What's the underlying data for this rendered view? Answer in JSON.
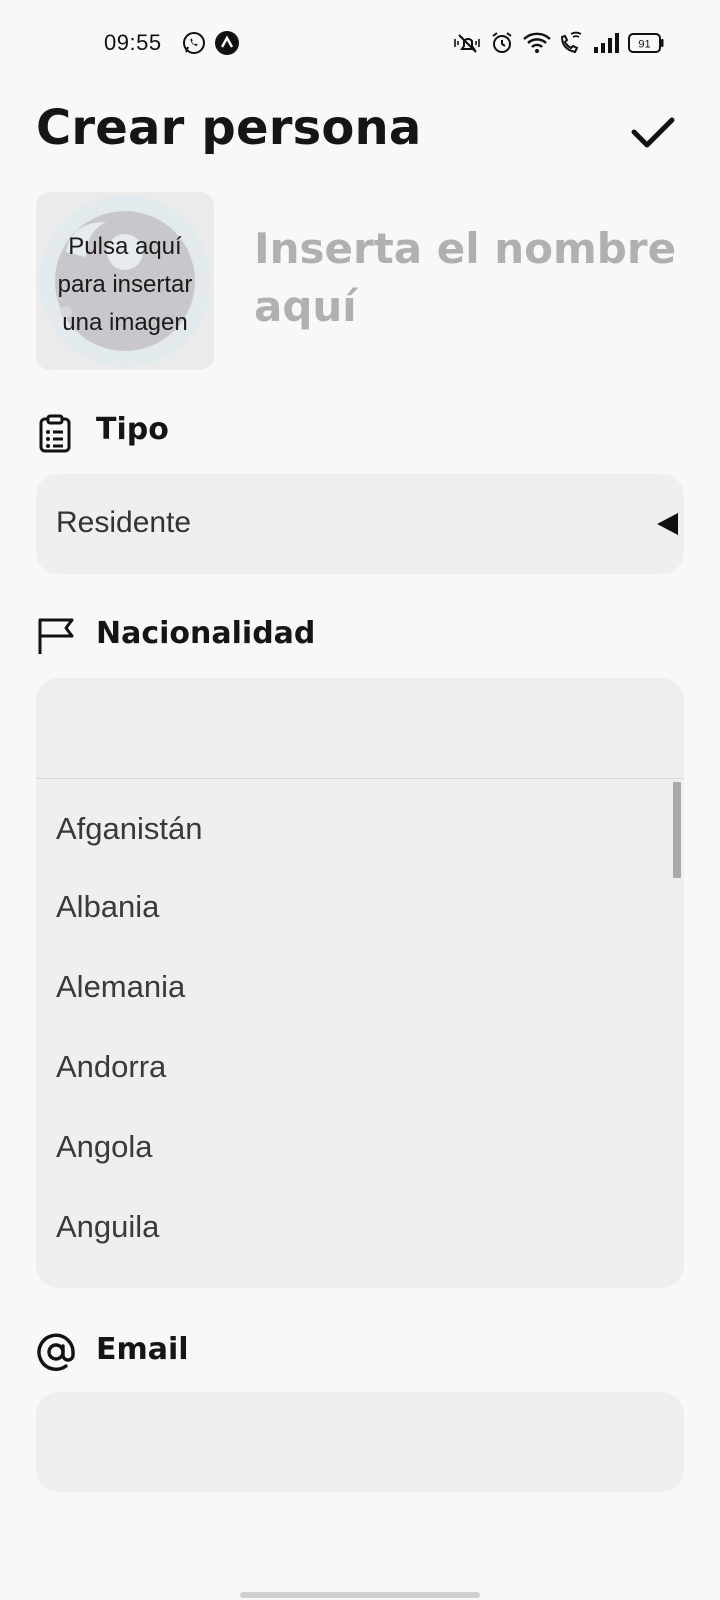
{
  "status_bar": {
    "time": "09:55",
    "battery": "91",
    "icons": [
      "whatsapp-icon",
      "app-icon",
      "mute-vibrate-icon",
      "alarm-icon",
      "wifi-icon",
      "wifi-calling-icon",
      "signal-icon",
      "battery-icon"
    ]
  },
  "header": {
    "title": "Crear persona",
    "confirm_icon": "check-icon"
  },
  "image_picker": {
    "label": "Pulsa aquí para insertar una imagen",
    "line1": "Pulsa aquí",
    "line2": "para insertar",
    "line3": "una imagen"
  },
  "name_field": {
    "placeholder": "Inserta el nombre aquí"
  },
  "tipo": {
    "label": "Tipo",
    "icon": "clipboard-list-icon",
    "value": "Residente",
    "arrow_icon": "triangle-left-icon"
  },
  "nacionalidad": {
    "label": "Nacionalidad",
    "icon": "flag-icon",
    "value": "",
    "options": [
      "Afganistán",
      "Albania",
      "Alemania",
      "Andorra",
      "Angola",
      "Anguila"
    ]
  },
  "email": {
    "label": "Email",
    "icon": "at-icon",
    "value": ""
  }
}
